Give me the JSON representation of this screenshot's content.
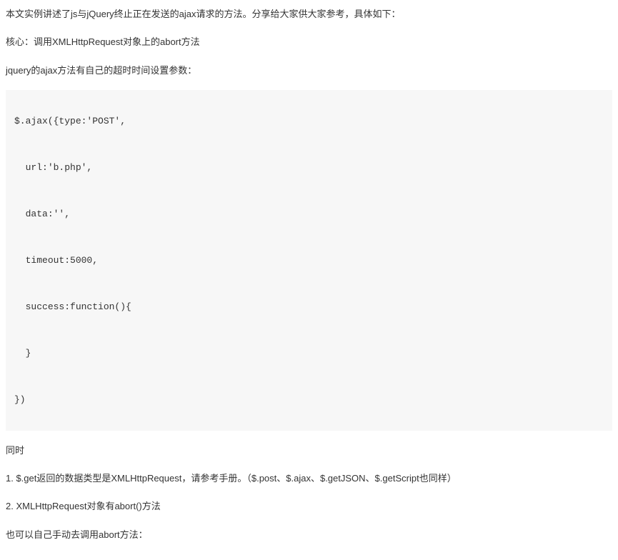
{
  "paragraphs": {
    "intro": "本文实例讲述了js与jQuery终止正在发送的ajax请求的方法。分享给大家供大家参考，具体如下：",
    "core": "核心：调用XMLHttpRequest对象上的abort方法",
    "jquery_param": "jquery的ajax方法有自己的超时时间设置参数：",
    "meanwhile": "同时",
    "point1": "1. $.get返回的数据类型是XMLHttpRequest，请参考手册。（$.post、$.ajax、$.getJSON、$.getScript也同样）",
    "point2": "2. XMLHttpRequest对象有abort()方法",
    "manual": "也可以自己手动去调用abort方法："
  },
  "code": {
    "l1": "$.ajax({type:'POST',",
    "l2": "  url:'b.php',",
    "l3": "  data:'',",
    "l4": "  timeout:5000,",
    "l5": "  success:function(){",
    "l6": "  }",
    "l7": "})"
  }
}
